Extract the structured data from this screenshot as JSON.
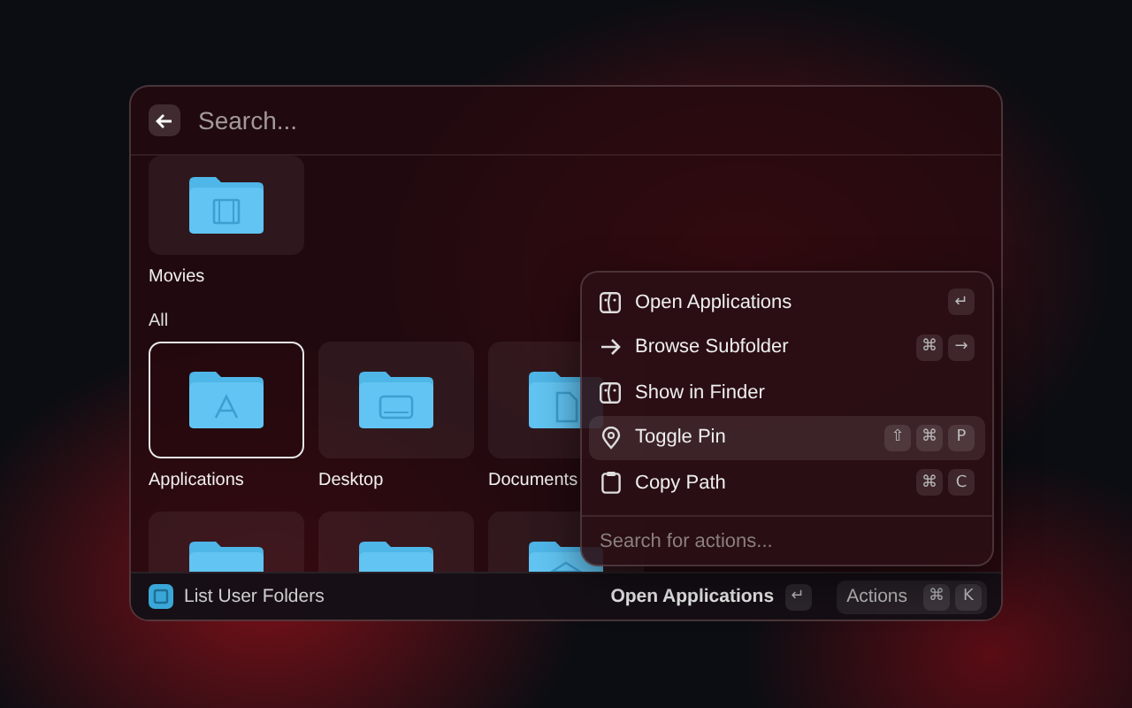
{
  "search": {
    "placeholder": "Search..."
  },
  "pinned": [
    {
      "label": "Movies",
      "kind": "movies",
      "selected": false
    }
  ],
  "section": "All",
  "folders": [
    {
      "label": "Applications",
      "kind": "applications",
      "selected": true
    },
    {
      "label": "Desktop",
      "kind": "desktop",
      "selected": false
    },
    {
      "label": "Documents",
      "kind": "documents",
      "selected": false
    },
    {
      "kind": "plain",
      "selected": false
    },
    {
      "kind": "plain",
      "selected": false
    },
    {
      "kind": "library",
      "selected": false
    }
  ],
  "footer": {
    "title": "List User Folders",
    "primary_action": "Open Applications",
    "primary_keys": [
      "↵"
    ],
    "actions_label": "Actions",
    "actions_keys": [
      "⌘",
      "K"
    ]
  },
  "actions_menu": {
    "items": [
      {
        "label": "Open Applications",
        "kind": "finder",
        "keys": [
          "↵"
        ],
        "selected": false
      },
      {
        "label": "Browse Subfolder",
        "kind": "arrow",
        "keys": [
          "⌘",
          "→"
        ],
        "selected": false
      },
      {
        "label": "Show in Finder",
        "kind": "finder",
        "selected": false
      },
      {
        "label": "Toggle Pin",
        "kind": "pin",
        "keys": [
          "⇧",
          "⌘",
          "P"
        ],
        "selected": true
      },
      {
        "label": "Copy Path",
        "kind": "clipboard",
        "keys": [
          "⌘",
          "C"
        ],
        "selected": false
      }
    ],
    "placeholder": "Search for actions..."
  }
}
